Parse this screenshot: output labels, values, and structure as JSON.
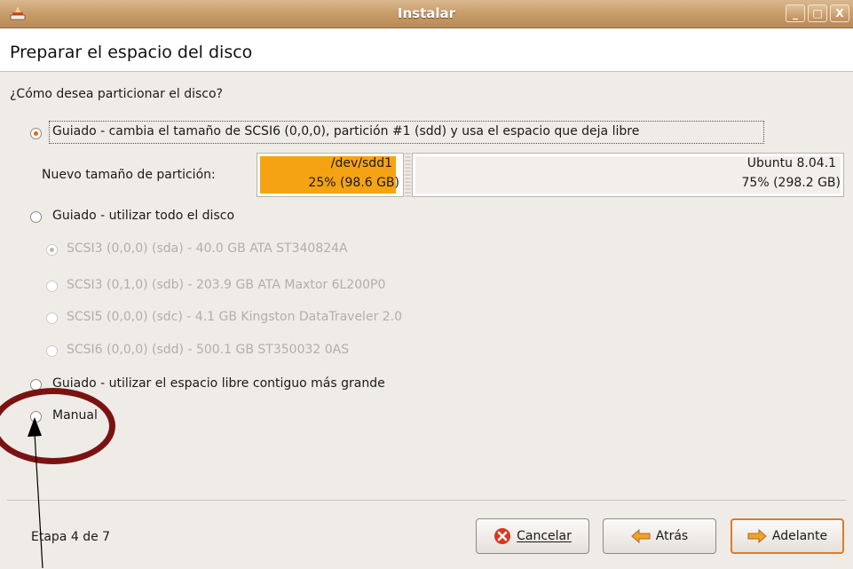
{
  "window": {
    "title": "Instalar",
    "controls": [
      "_",
      "□",
      "X"
    ]
  },
  "header": {
    "title": "Preparar el espacio del disco"
  },
  "question": "¿Cómo desea particionar el disco?",
  "options": [
    {
      "label": "Guiado - cambia el tamaño de SCSI6 (0,0,0), partición #1 (sdd) y usa el espacio que deja libre",
      "selected": true
    },
    {
      "label": "Guiado - utilizar todo el disco",
      "selected": false
    },
    {
      "label": "Guiado - utilizar el espacio libre contiguo más grande",
      "selected": false
    },
    {
      "label": "Manual",
      "selected": false
    }
  ],
  "resize": {
    "label": "Nuevo tamaño de partición:",
    "left": {
      "name": "/dev/sdd1",
      "usage": "25% (98.6 GB)",
      "fraction": 0.25,
      "color": "#f6a313"
    },
    "right": {
      "name": "Ubuntu 8.04.1",
      "usage": "75% (298.2 GB)",
      "fraction": 0.75
    }
  },
  "disks": [
    {
      "label": "SCSI3 (0,0,0) (sda) - 40.0 GB ATA ST340824A",
      "selected": true,
      "enabled": false
    },
    {
      "label": "SCSI3 (0,1,0) (sdb) - 203.9 GB ATA Maxtor 6L200P0",
      "selected": false,
      "enabled": false
    },
    {
      "label": "SCSI5 (0,0,0) (sdc) - 4.1 GB Kingston DataTraveler 2.0",
      "selected": false,
      "enabled": false
    },
    {
      "label": "SCSI6 (0,0,0) (sdd) - 500.1 GB ST350032 0AS",
      "selected": false,
      "enabled": false
    }
  ],
  "footer": {
    "step": "Etapa 4 de 7",
    "cancel": "Cancelar",
    "back": "Atrás",
    "forward": "Adelante"
  },
  "colors": {
    "titlebar": "#c99f6c",
    "accent": "#e06a1b",
    "annotation": "#7a1212"
  }
}
